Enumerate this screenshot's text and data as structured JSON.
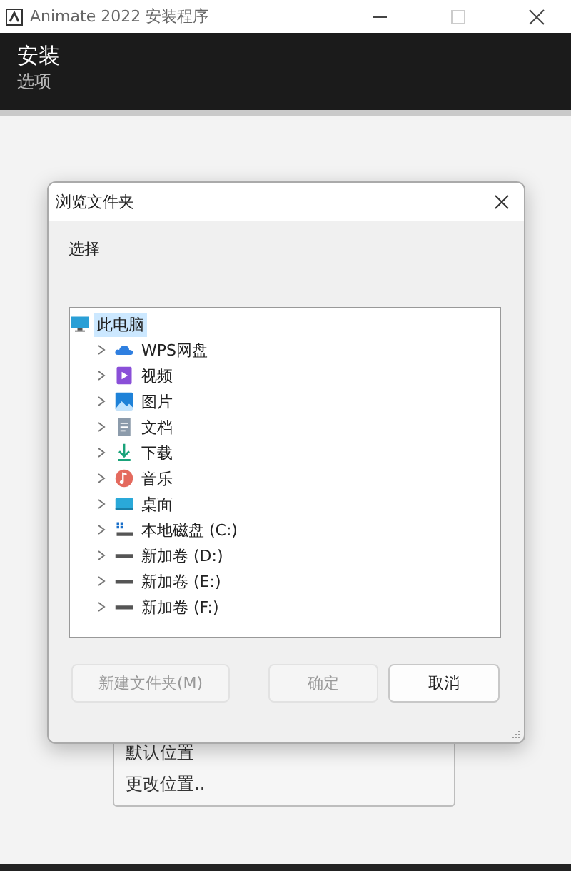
{
  "window": {
    "title": "Animate 2022 安装程序"
  },
  "header": {
    "title": "安装",
    "subtitle": "选项"
  },
  "location_menu": {
    "items": [
      "默认位置",
      "更改位置.."
    ]
  },
  "dialog": {
    "title": "浏览文件夹",
    "prompt": "选择",
    "tree": [
      {
        "label": "此电脑",
        "kind": "computer",
        "selected": true,
        "children": [
          {
            "label": "WPS网盘",
            "kind": "cloud",
            "selected": false,
            "expanded": false
          },
          {
            "label": "视频",
            "kind": "video",
            "selected": false,
            "expanded": false
          },
          {
            "label": "图片",
            "kind": "pictures",
            "selected": false,
            "expanded": false
          },
          {
            "label": "文档",
            "kind": "documents",
            "selected": false,
            "expanded": false
          },
          {
            "label": "下载",
            "kind": "download",
            "selected": false,
            "expanded": false
          },
          {
            "label": "音乐",
            "kind": "music",
            "selected": false,
            "expanded": false
          },
          {
            "label": "桌面",
            "kind": "desktop",
            "selected": false,
            "expanded": false
          },
          {
            "label": "本地磁盘 (C:)",
            "kind": "system-drive",
            "selected": false,
            "expanded": false
          },
          {
            "label": "新加卷 (D:)",
            "kind": "drive",
            "selected": false,
            "expanded": false
          },
          {
            "label": "新加卷 (E:)",
            "kind": "drive",
            "selected": false,
            "expanded": false
          },
          {
            "label": "新加卷 (F:)",
            "kind": "drive",
            "selected": false,
            "expanded": false
          }
        ]
      }
    ],
    "buttons": [
      {
        "label": "新建文件夹(M)",
        "disabled": true
      },
      {
        "label": "确定",
        "disabled": true
      },
      {
        "label": "取消",
        "disabled": false
      }
    ]
  }
}
